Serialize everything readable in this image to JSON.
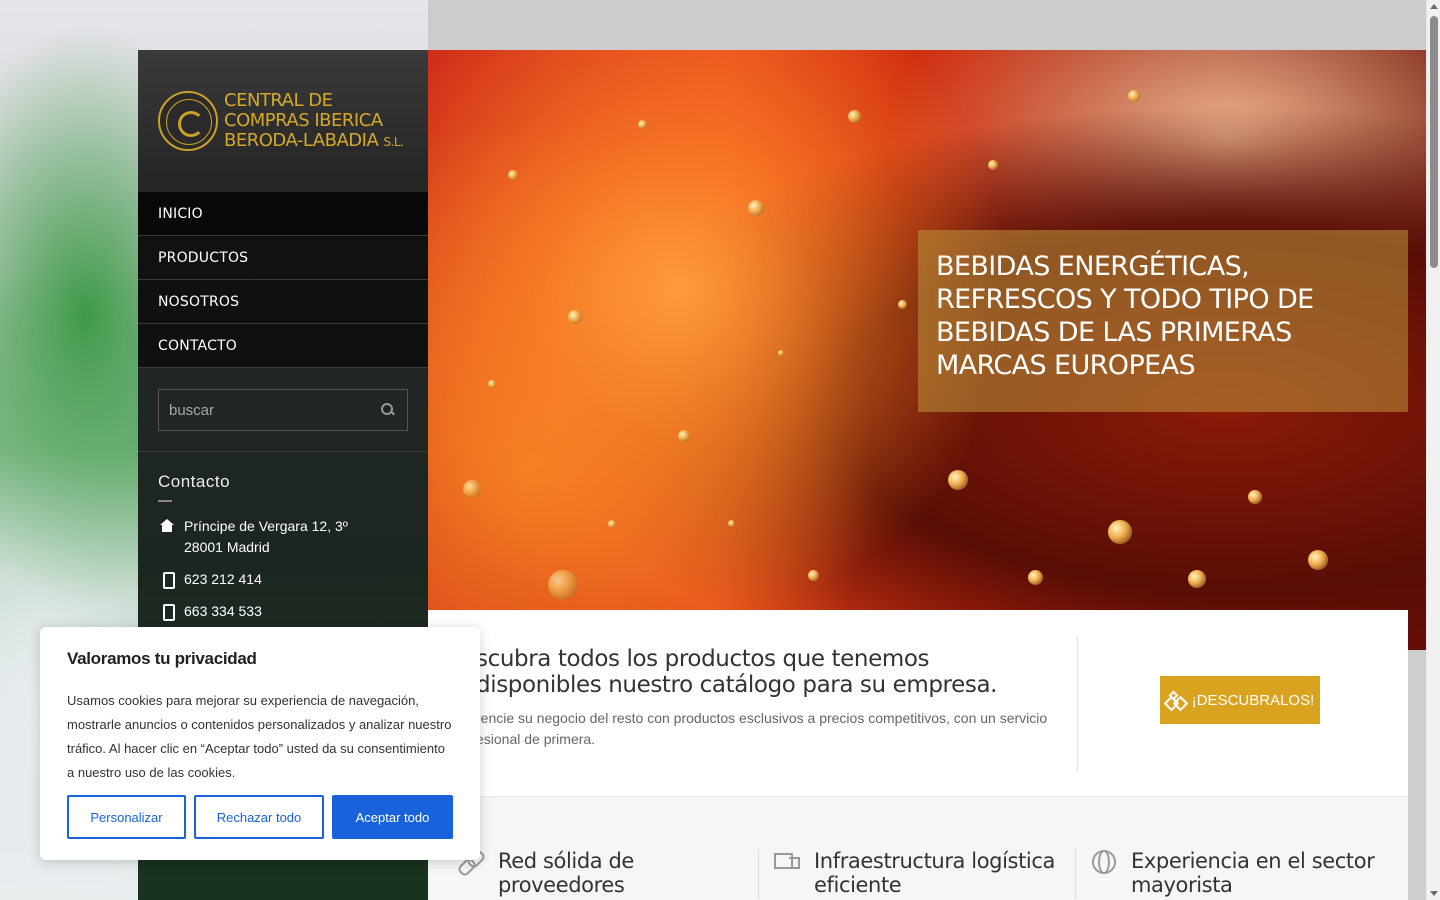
{
  "brand": {
    "seal_text": "BERODA LABADIA",
    "name_line1": "CENTRAL DE",
    "name_line2": "COMPRAS IBERICA",
    "name_line3": "BERODA-LABADIA",
    "name_suffix": "S.L.",
    "color": "#d4a92a"
  },
  "nav": {
    "items": [
      {
        "label": "INICIO"
      },
      {
        "label": "PRODUCTOS"
      },
      {
        "label": "NOSOTROS"
      },
      {
        "label": "CONTACTO"
      }
    ]
  },
  "search": {
    "placeholder": "buscar"
  },
  "contact": {
    "title": "Contacto",
    "address_line1": "Príncipe de Vergara 12, 3º",
    "address_line2": "28001 Madrid",
    "phone1": "623 212 414",
    "phone2": "663 334 533"
  },
  "hero": {
    "caption": "BEBIDAS ENERGÉTICAS, REFRESCOS Y TODO TIPO DE BEBIDAS DE LAS PRIMERAS MARCAS EUROPEAS"
  },
  "promo": {
    "title": "scubra todos los productos que tenemos disponibles nuestro catálogo para su empresa.",
    "subtitle": "rencie su negocio del resto con productos esclusivos a precios competitivos, con un servicio esional de primera.",
    "button_label": "¡DESCUBRALOS!",
    "accent": "#d9a320"
  },
  "features": [
    {
      "icon": "link-icon",
      "title": "Red sólida de proveedores"
    },
    {
      "icon": "truck-icon",
      "title": "Infraestructura logística eficiente"
    },
    {
      "icon": "globe-icon",
      "title": "Experiencia en el sector mayorista"
    }
  ],
  "cookie": {
    "title": "Valoramos tu privacidad",
    "text": "Usamos cookies para mejorar su experiencia de navegación, mostrarle anuncios o contenidos personalizados y analizar nuestro tráfico. Al hacer clic en “Aceptar todo” usted da su consentimiento a nuestro uso de las cookies.",
    "customize_label": "Personalizar",
    "reject_label": "Rechazar todo",
    "accept_label": "Aceptar todo",
    "accent": "#1863dc"
  }
}
